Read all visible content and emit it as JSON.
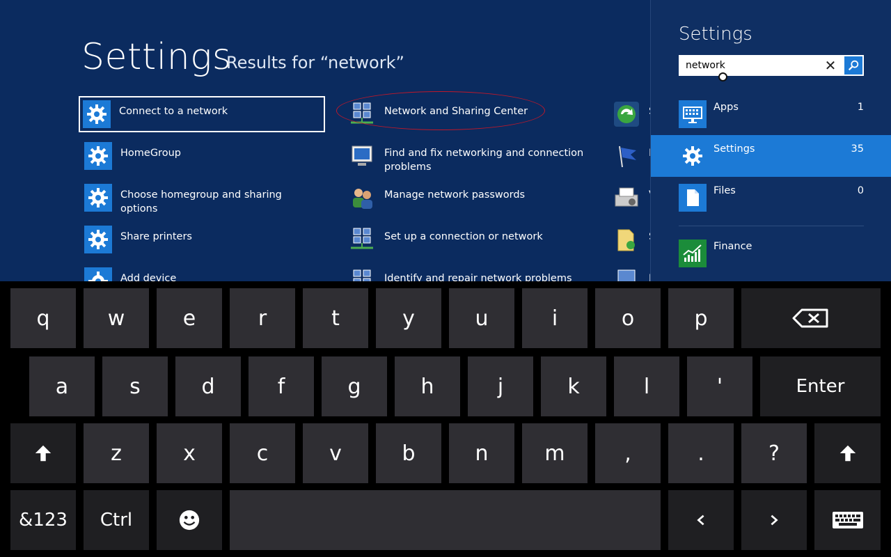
{
  "results": {
    "title": "Settings",
    "subtitle": "Results for “network”",
    "col1": [
      {
        "label": "Connect to a network",
        "icon": "gear-icon"
      },
      {
        "label": "HomeGroup",
        "icon": "gear-icon"
      },
      {
        "label": "Choose homegroup and sharing options",
        "icon": "gear-icon"
      },
      {
        "label": "Share printers",
        "icon": "gear-icon"
      },
      {
        "label": "Add device",
        "icon": "gear-icon"
      }
    ],
    "col2": [
      {
        "label": "Network and Sharing Center",
        "icon": "network-icon"
      },
      {
        "label": "Find and fix networking and connection problems",
        "icon": "network-troubleshoot-icon"
      },
      {
        "label": "Manage network passwords",
        "icon": "users-icon"
      },
      {
        "label": "Set up a connection or network",
        "icon": "network-icon"
      },
      {
        "label": "Identify and repair network problems",
        "icon": "network-icon"
      }
    ],
    "col3_partial": [
      {
        "label": "S",
        "icon": "sync-icon"
      },
      {
        "label": "F",
        "icon": "flag-icon"
      },
      {
        "label": "V",
        "icon": "printer-icon"
      },
      {
        "label": "S",
        "icon": "folder-icon"
      },
      {
        "label": "I",
        "icon": "network-icon"
      }
    ]
  },
  "charms": {
    "title": "Settings",
    "search": {
      "value": "network",
      "placeholder": ""
    },
    "scopes": [
      {
        "label": "Apps",
        "count": "1",
        "icon": "keyboard-app-icon"
      },
      {
        "label": "Settings",
        "count": "35",
        "icon": "gear-icon"
      },
      {
        "label": "Files",
        "count": "0",
        "icon": "file-icon"
      }
    ],
    "apps": [
      {
        "label": "Finance",
        "icon": "finance-chart-icon"
      }
    ]
  },
  "keyboard": {
    "row1": [
      "q",
      "w",
      "e",
      "r",
      "t",
      "y",
      "u",
      "i",
      "o",
      "p"
    ],
    "row2": [
      "a",
      "s",
      "d",
      "f",
      "g",
      "h",
      "j",
      "k",
      "l",
      "'"
    ],
    "enter": "Enter",
    "row3": [
      "z",
      "x",
      "c",
      "v",
      "b",
      "n",
      "m",
      ",",
      ".",
      "?"
    ],
    "numkey": "&123",
    "ctrl": "Ctrl"
  },
  "colors": {
    "accent": "#1c7ad6",
    "background": "#0b2b5f",
    "key": "#2f2e33",
    "annotation": "#c0182a"
  }
}
